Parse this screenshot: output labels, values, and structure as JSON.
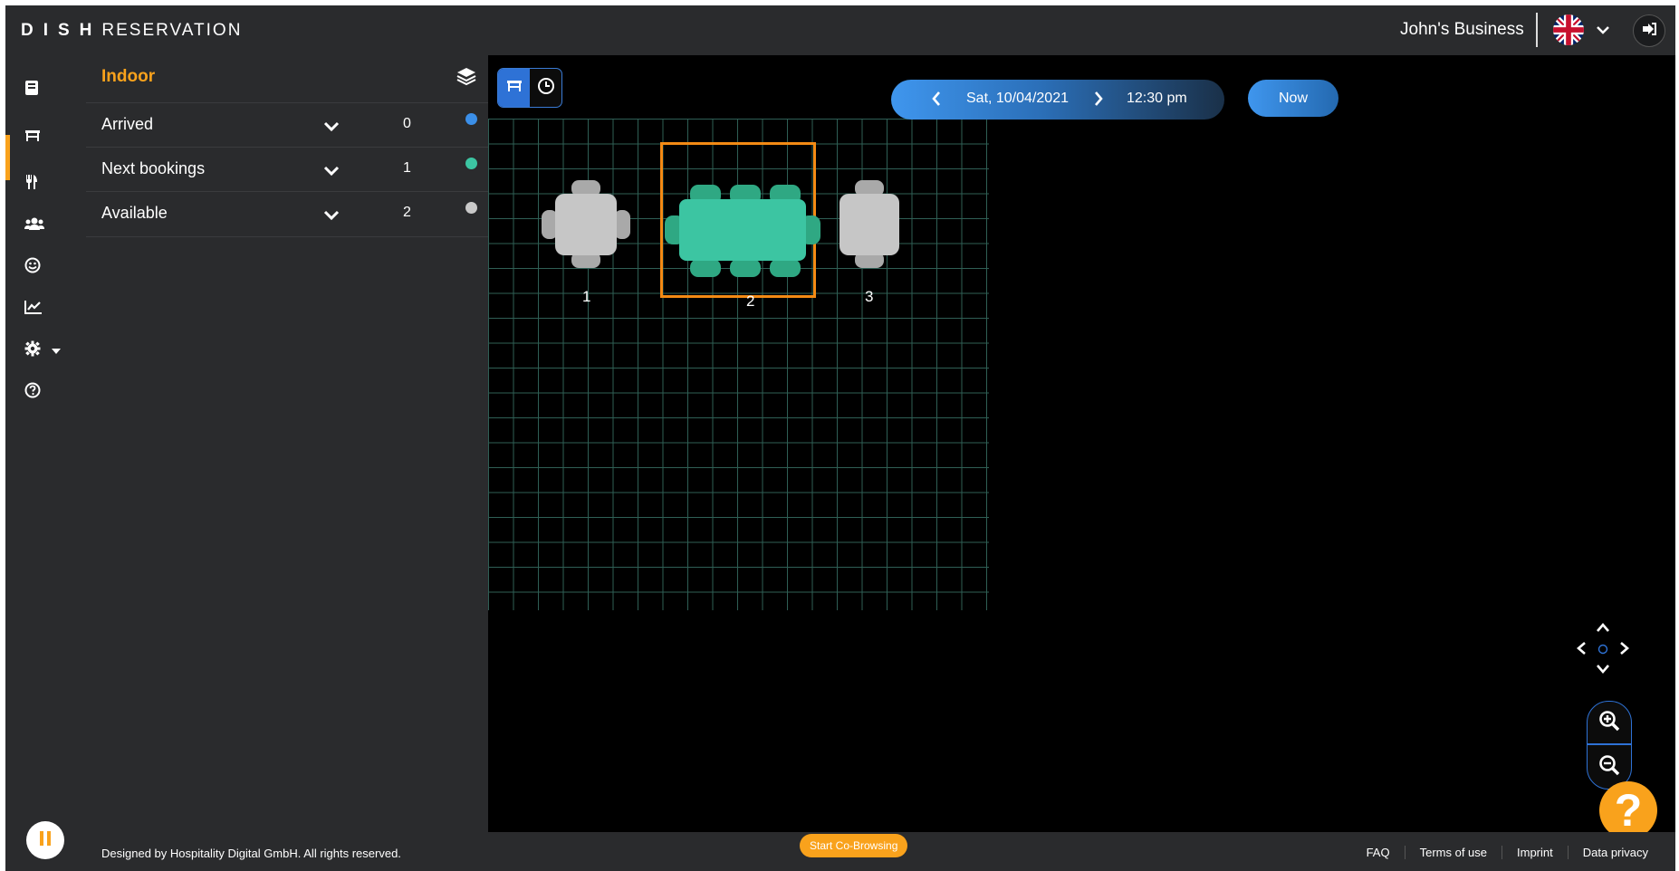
{
  "header": {
    "brand_bold": "DISH",
    "brand_light": "RESERVATION",
    "business_name": "John's Business",
    "language_icon": "uk-flag-icon",
    "logout_icon": "logout-icon"
  },
  "sidebar": {
    "items": [
      {
        "name": "reservations",
        "icon": "book-icon"
      },
      {
        "name": "table-plan",
        "icon": "table-icon",
        "active": true
      },
      {
        "name": "menu",
        "icon": "cutlery-icon"
      },
      {
        "name": "guests",
        "icon": "users-icon"
      },
      {
        "name": "feedback",
        "icon": "smile-icon"
      },
      {
        "name": "reports",
        "icon": "chart-icon"
      },
      {
        "name": "settings",
        "icon": "gear-icon"
      },
      {
        "name": "help",
        "icon": "question-icon"
      }
    ],
    "accent_color": "#f9a21c"
  },
  "panel": {
    "title": "Indoor",
    "rows": [
      {
        "label": "Arrived",
        "count": "0",
        "color": "#3b8fe8"
      },
      {
        "label": "Next bookings",
        "count": "1",
        "color": "#3cc5a2"
      },
      {
        "label": "Available",
        "count": "2",
        "color": "#c9c9c9"
      }
    ]
  },
  "toolbar": {
    "date": "Sat, 10/04/2021",
    "time": "12:30 pm",
    "now_label": "Now"
  },
  "floor": {
    "tables": [
      {
        "number": "1",
        "status": "available"
      },
      {
        "number": "2",
        "status": "next-booking",
        "selected": true
      },
      {
        "number": "3",
        "status": "available"
      }
    ]
  },
  "footer": {
    "copyright": "Designed by Hospitality Digital GmbH. All rights reserved.",
    "cobrowse_label": "Start Co-Browsing",
    "links": [
      "FAQ",
      "Terms of use",
      "Imprint",
      "Data privacy"
    ]
  }
}
